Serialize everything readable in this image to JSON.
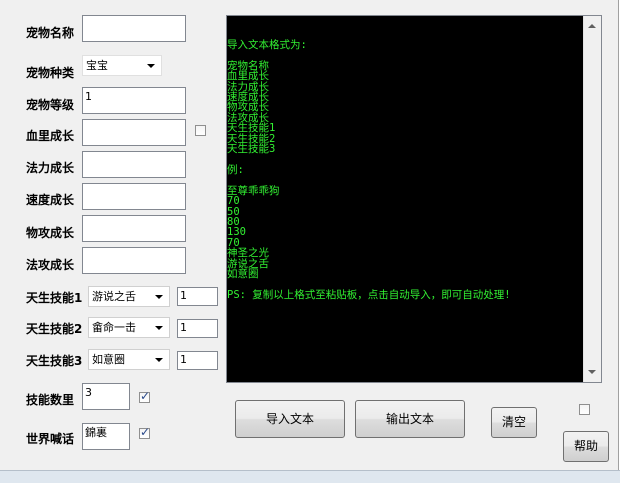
{
  "form": {
    "pet_name_label": "宠物名称",
    "pet_name_value": "",
    "pet_species_label": "宠物种类",
    "pet_species_value": "宝宝",
    "pet_level_label": "宠物等级",
    "pet_level_value": "1",
    "hp_growth_label": "血里成长",
    "hp_growth_value": "",
    "mp_growth_label": "法力成长",
    "mp_growth_value": "",
    "speed_growth_label": "速度成长",
    "speed_growth_value": "",
    "phys_atk_growth_label": "物攻成长",
    "phys_atk_growth_value": "",
    "mag_atk_growth_label": "法攻成长",
    "mag_atk_growth_value": "",
    "skill1_label": "天生技能1",
    "skill1_value": "游说之舌",
    "skill1_level": "1",
    "skill2_label": "天生技能2",
    "skill2_value": "畲命一击",
    "skill2_level": "1",
    "skill3_label": "天生技能3",
    "skill3_value": "如意圈",
    "skill3_level": "1",
    "skill_count_label": "技能数里",
    "skill_count_value": "3",
    "world_shout_label": "世界喊话",
    "world_shout_value": "錦裏",
    "hp_growth_checked": false,
    "skill_count_checked": true,
    "world_shout_checked": true,
    "top_right_checked": false
  },
  "buttons": {
    "import_text": "导入文本",
    "export_text": "输出文本",
    "clear": "清空",
    "help": "帮助"
  },
  "console": {
    "lines": [
      "导入文本格式为:",
      "",
      "宠物名称",
      "血里成长",
      "法力成长",
      "速度成长",
      "物攻成长",
      "法攻成长",
      "天生技能1",
      "天生技能2",
      "天生技能3",
      "",
      "例:",
      "",
      "至尊乖乖狗",
      "70",
      "50",
      "80",
      "130",
      "70",
      "神圣之光",
      "游说之舌",
      "如意圈",
      "",
      "PS: 复制以上格式至粘贴板，点击自动导入，即可自动处理!"
    ]
  }
}
